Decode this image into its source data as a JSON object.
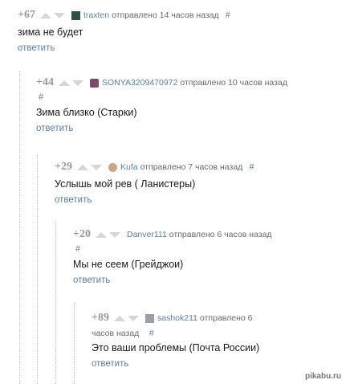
{
  "comments": [
    {
      "rating": "+67",
      "user": "traxten",
      "meta": "отправлено 14 часов назад",
      "hash": "#",
      "text": "зима не будет",
      "reply": "ответить"
    },
    {
      "rating": "+44",
      "user": "SONYA3209470972",
      "meta": "отправлено 10 часов назад",
      "hash": "#",
      "text": "Зима близко (Старки)",
      "reply": "ответить"
    },
    {
      "rating": "+29",
      "user": "Kufa",
      "meta": "отправлено 7 часов назад",
      "hash": "#",
      "text": "Услышь мой рев ( Ланистеры)",
      "reply": "ответить"
    },
    {
      "rating": "+20",
      "user": "Danver111",
      "meta": "отправлено 6 часов назад",
      "hash": "#",
      "text": "Мы не сеем (Грейджои)",
      "reply": "ответить"
    },
    {
      "rating": "+89",
      "user": "sashok211",
      "meta": "отправлено 6",
      "meta2": "часов назад",
      "hash": "#",
      "text": "Это ваши проблемы (Почта России)",
      "reply": "ответить"
    }
  ],
  "watermark": "pikabu.ru",
  "colors": {
    "link": "#5a7fa8",
    "rating": "#9a9a9a",
    "vote_arrow": "#d6d6d6",
    "thread_line": "#c7c7c7"
  }
}
